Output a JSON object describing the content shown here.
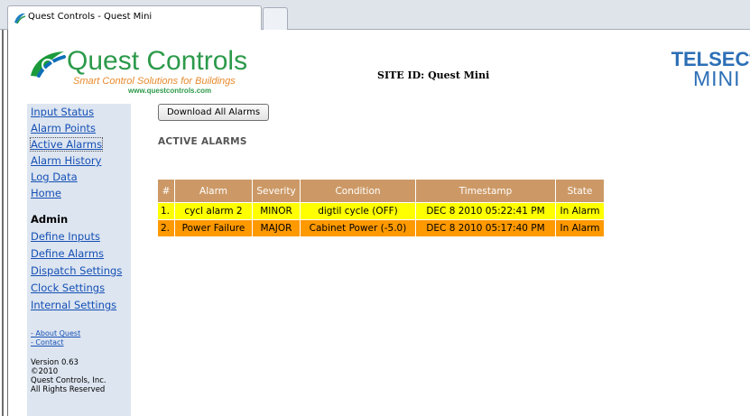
{
  "browser": {
    "tab_title": "Quest Controls - Quest Mini",
    "tab_icon": "quest-logo-icon"
  },
  "header": {
    "logo_name": "Quest Controls",
    "logo_tagline": "Smart Control Solutions for Buildings",
    "logo_url": "www.questcontrols.com",
    "site_id": "SITE ID: Quest Mini",
    "product_name": "TELSEC",
    "product_reg": "®",
    "product_model": "MINI"
  },
  "sidebar": {
    "nav": [
      {
        "label": "Input Status"
      },
      {
        "label": "Alarm Points"
      },
      {
        "label": "Active Alarms"
      },
      {
        "label": "Alarm History"
      },
      {
        "label": "Log Data"
      },
      {
        "label": "Home"
      }
    ],
    "admin_title": "Admin",
    "admin_nav": [
      {
        "label": "Define Inputs"
      },
      {
        "label": "Define Alarms"
      },
      {
        "label": "Dispatch Settings"
      },
      {
        "label": "Clock Settings"
      },
      {
        "label": "Internal Settings"
      }
    ],
    "about_link": "- About Quest",
    "contact_link": "- Contact",
    "version_lines": [
      "Version 0.63",
      "©2010",
      "Quest Controls, Inc.",
      "All Rights Reserved"
    ]
  },
  "main": {
    "download_button": "Download All Alarms",
    "heading": "ACTIVE ALARMS",
    "table": {
      "columns": [
        "#",
        "Alarm",
        "Severity",
        "Condition",
        "Timestamp",
        "State"
      ],
      "rows": [
        {
          "num": "1.",
          "alarm": "cycl alarm 2",
          "severity": "MINOR",
          "condition": "digtil cycle (OFF)",
          "timestamp": "DEC 8 2010 05:22:41 PM",
          "state": "In Alarm"
        },
        {
          "num": "2.",
          "alarm": "Power Failure",
          "severity": "MAJOR",
          "condition": "Cabinet Power (-5.0)",
          "timestamp": "DEC 8 2010 05:17:40 PM",
          "state": "In Alarm"
        }
      ]
    }
  },
  "colors": {
    "brand_green": "#2c9a4a",
    "brand_orange": "#e8892b",
    "telsec_blue": "#2c6fb6",
    "sidebar_bg": "#dde5f0",
    "table_header": "#cc9966",
    "minor_row": "#ffff00",
    "major_row": "#ff9900",
    "link": "#1550b5"
  }
}
